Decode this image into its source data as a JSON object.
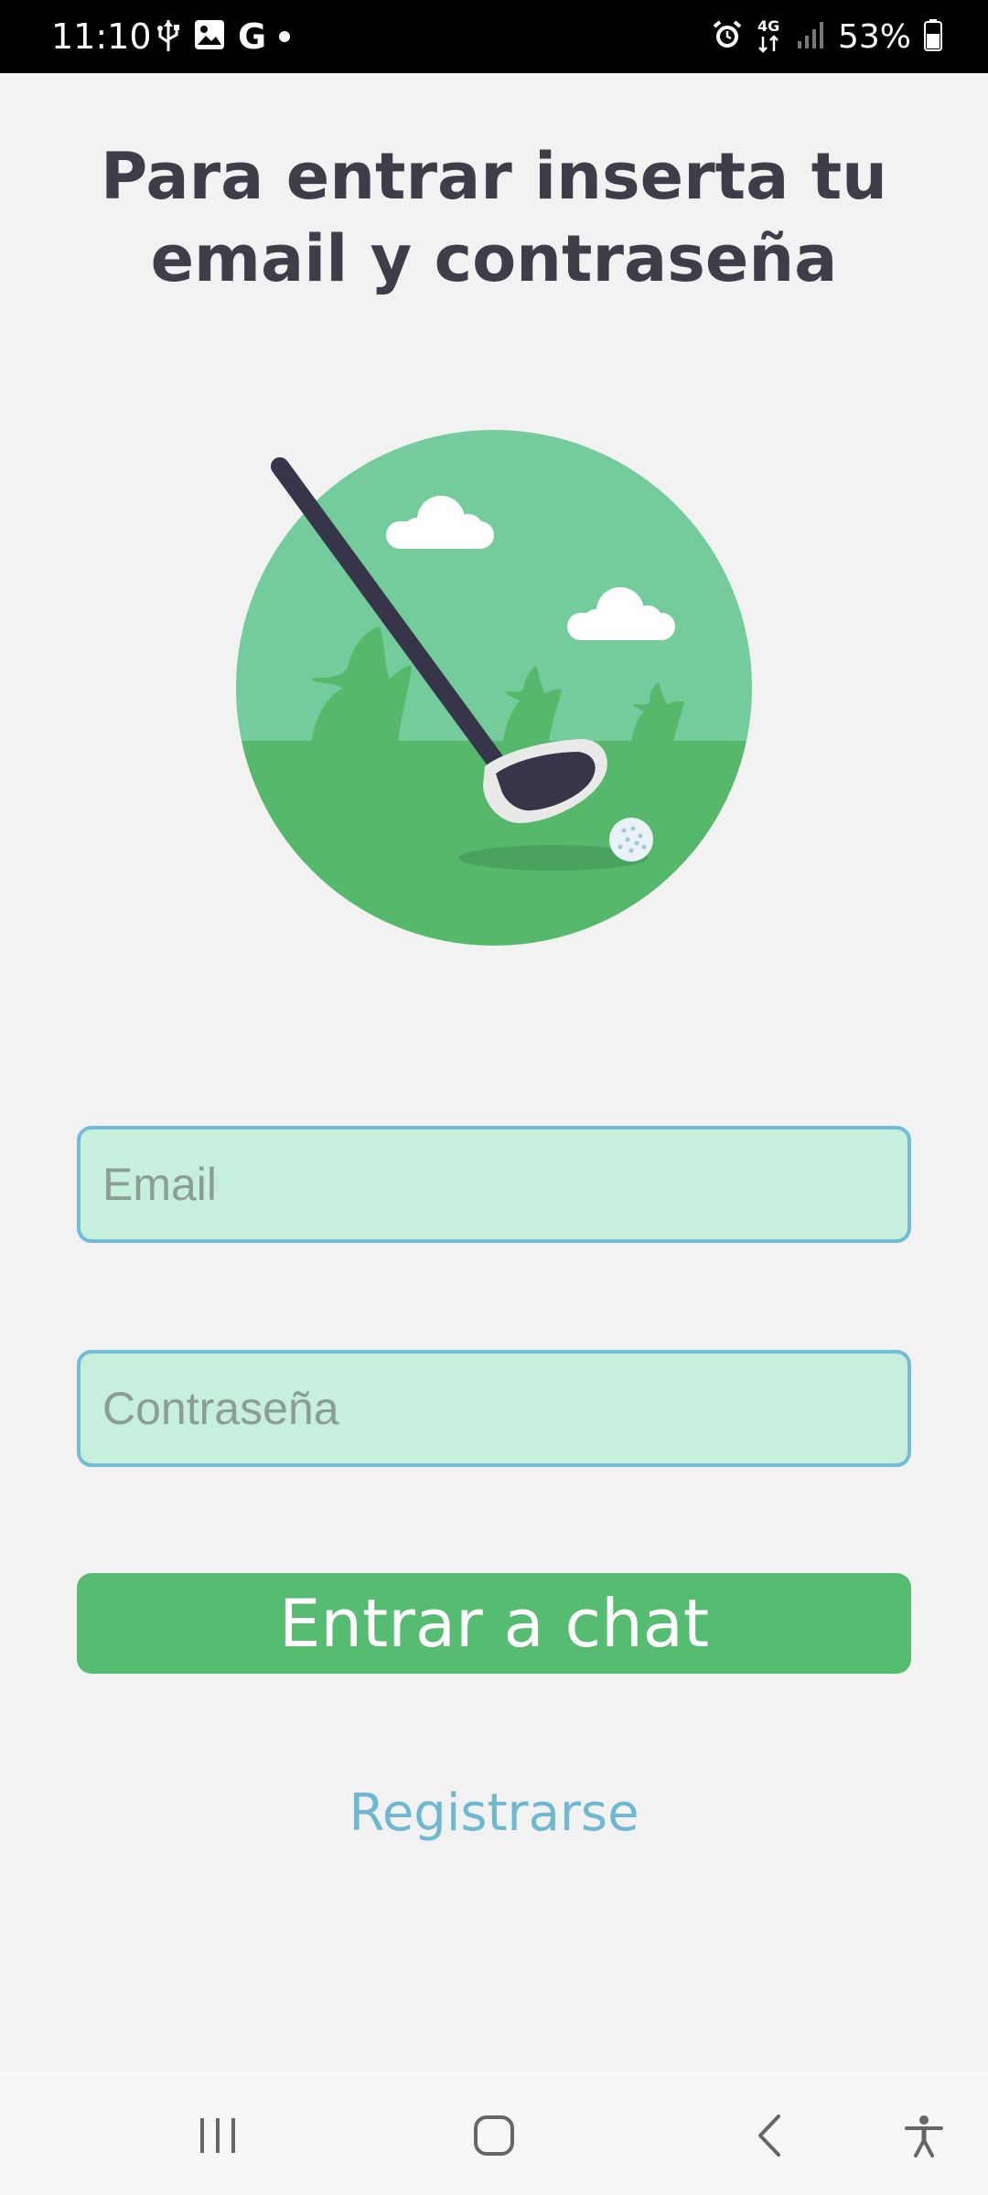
{
  "status_bar": {
    "time": "11:10",
    "battery": "53%",
    "network": "4G",
    "icons": [
      "usb-icon",
      "image-icon",
      "google-icon",
      "notification-dot-icon",
      "alarm-icon",
      "network-4g-icon",
      "signal-icon",
      "battery-icon"
    ]
  },
  "login": {
    "title": "Para entrar inserta tu email y contraseña",
    "email_placeholder": "Email",
    "password_placeholder": "Contraseña",
    "submit_label": "Entrar a chat",
    "register_label": "Registrarse"
  },
  "illustration": {
    "icon": "golf-illustration",
    "colors": {
      "sky": "#74cb9c",
      "grass": "#56b86b",
      "club": "#37354a",
      "cloud": "#ffffff"
    }
  },
  "nav_bar": {
    "icons": [
      "recent-apps-icon",
      "home-icon",
      "back-icon",
      "accessibility-icon"
    ]
  },
  "theme": {
    "accent": "#55bc71",
    "input_bg": "#c6f0db",
    "input_border": "#72bcd8",
    "link": "#6fb8d2",
    "title_color": "#3e3d48"
  }
}
